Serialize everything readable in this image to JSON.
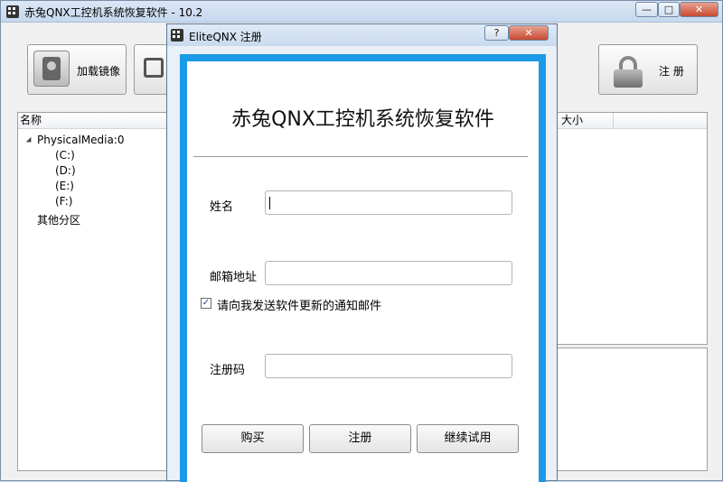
{
  "main_window": {
    "title": "赤兔QNX工控机系统恢复软件 - 10.2",
    "controls": {
      "minimize": "—",
      "maximize": "□",
      "close": "✕"
    },
    "toolbar": {
      "load_image_label": "加载镜像",
      "register_label": "注 册"
    },
    "tree": {
      "column_name": "名称",
      "column_size": "大小",
      "items": [
        "PhysicalMedia:0",
        "(C:)",
        "(D:)",
        "(E:)",
        "(F:)",
        "其他分区"
      ]
    }
  },
  "dialog": {
    "title": "EliteQNX 注册",
    "controls": {
      "help": "?",
      "close": "✕"
    },
    "heading": "赤兔QNX工控机系统恢复软件",
    "name_label": "姓名",
    "name_value": "",
    "email_label": "邮箱地址",
    "email_value": "",
    "notify_label": "请向我发送软件更新的通知邮件",
    "notify_checked": true,
    "code_label": "注册码",
    "code_value": "",
    "buttons": {
      "buy": "购买",
      "register": "注册",
      "trial": "继续试用"
    }
  },
  "colors": {
    "accent_border": "#1a9ae6",
    "titlebar": "#c9daee"
  }
}
